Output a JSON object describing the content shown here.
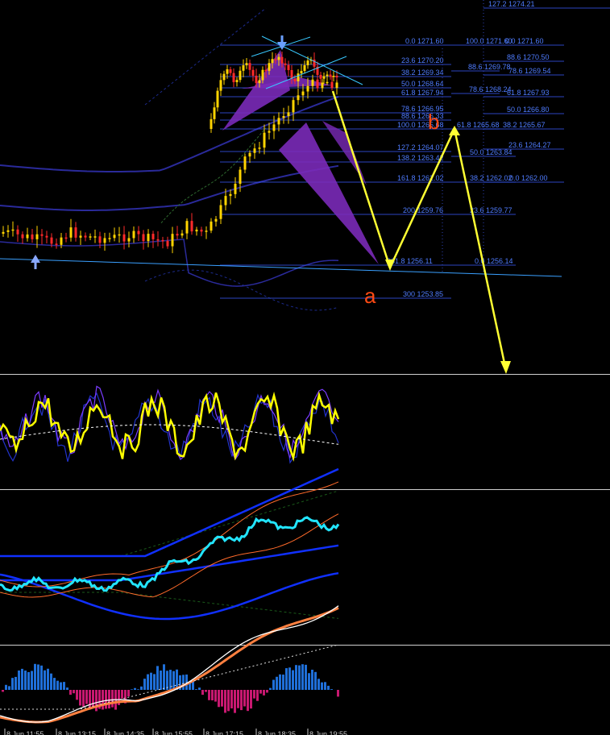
{
  "chart_data": [
    {
      "type": "candlestick",
      "title": "",
      "price_levels": [
        {
          "label": "127.2 1274.21"
        },
        {
          "label": "0.0 1271.60"
        },
        {
          "label": "100.0 1271.60"
        },
        {
          "label": "0.0 1271.60"
        },
        {
          "label": "88.6 1270.50"
        },
        {
          "label": "23.6 1270.20"
        },
        {
          "label": "88.6 1269.78"
        },
        {
          "label": "38.2 1269.34"
        },
        {
          "label": "78.6 1269.54"
        },
        {
          "label": "50.0 1268.64"
        },
        {
          "label": "78.6 1268.24"
        },
        {
          "label": "61.8 1267.94"
        },
        {
          "label": "61.8 1267.93"
        },
        {
          "label": "78.6 1266.95"
        },
        {
          "label": "50.0 1266.80"
        },
        {
          "label": "88.6 1266.33"
        },
        {
          "label": "100.0 1265.68"
        },
        {
          "label": "61.8 1265.68"
        },
        {
          "label": "38.2 1265.67"
        },
        {
          "label": "127.2 1264.07"
        },
        {
          "label": "23.6 1264.27"
        },
        {
          "label": "50.0 1263.84"
        },
        {
          "label": "138.2 1263.42"
        },
        {
          "label": "161.8 1262.02"
        },
        {
          "label": "38.2 1262.02"
        },
        {
          "label": "0.0 1262.00"
        },
        {
          "label": "200 1259.76"
        },
        {
          "label": "23.6 1259.77"
        },
        {
          "label": "261.8 1256.11"
        },
        {
          "label": "0.0 1256.14"
        },
        {
          "label": "300 1253.85"
        }
      ],
      "wave_labels": {
        "a": "a",
        "b": "b"
      },
      "colors": {
        "bull_candle": "#ffd400",
        "bear_candle": "#ff2a2a",
        "fib_line": "#3a5cff",
        "fib_text": "#4f7cff",
        "projection": "#ffff33",
        "harmonic_pattern": "#7a2ab8",
        "trendline": "#3aa0ff",
        "bands": "#2a2a9a"
      }
    },
    {
      "type": "line",
      "title": "",
      "series_colors": [
        "#ffff00",
        "#7b3cff",
        "#2233cc",
        "#ffffff"
      ]
    },
    {
      "type": "line",
      "title": "",
      "series_colors": [
        "#22e5ff",
        "#ff6a2a",
        "#1030ff",
        "#1a5a1a"
      ]
    },
    {
      "type": "bar",
      "title": "",
      "histogram_colors": {
        "positive": "#1f6fd8",
        "negative": "#c81870"
      },
      "series_colors": [
        "#ffffff",
        "#ff8040"
      ],
      "x_ticks": [
        "8 Jun 11:55",
        "8 Jun 13:15",
        "8 Jun 14:35",
        "8 Jun 15:55",
        "8 Jun 17:15",
        "8 Jun 18:35",
        "8 Jun 19:55"
      ]
    }
  ]
}
